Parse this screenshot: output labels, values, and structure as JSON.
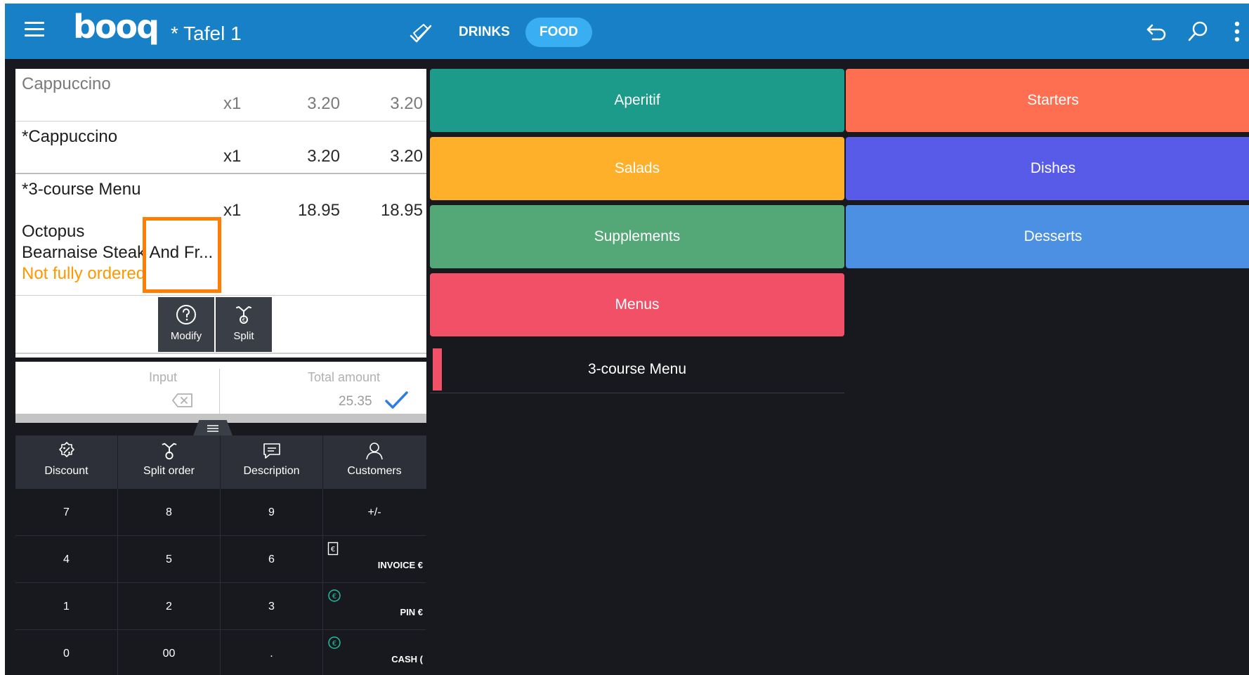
{
  "header": {
    "logo": "booq",
    "table_name": "* Tafel 1",
    "tabs": [
      {
        "label": "DRINKS",
        "active": false
      },
      {
        "label": "FOOD",
        "active": true
      }
    ],
    "icons": [
      "menu-icon",
      "pencil-check-icon",
      "undo-icon",
      "search-icon",
      "more-vertical-icon"
    ]
  },
  "order": {
    "items": [
      {
        "name": "Cappuccino",
        "qty": "x1",
        "price": "3.20",
        "total": "3.20"
      },
      {
        "name": "*Cappuccino",
        "qty": "x1",
        "price": "3.20",
        "total": "3.20"
      },
      {
        "name": "*3-course Menu",
        "qty": "x1",
        "price": "18.95",
        "total": "18.95",
        "subitems": [
          "Octopus",
          "Bearnaise Steak And Fr..."
        ],
        "status": "Not fully ordered"
      }
    ],
    "actions": {
      "modify": "Modify",
      "split": "Split"
    }
  },
  "summary": {
    "input_label": "Input",
    "total_label": "Total amount",
    "total_amount": "25.35"
  },
  "functions": {
    "discount": "Discount",
    "split_order": "Split order",
    "description": "Description",
    "customers": "Customers"
  },
  "keypad": {
    "k7": "7",
    "k8": "8",
    "k9": "9",
    "plusminus": "+/-",
    "k4": "4",
    "k5": "5",
    "k6": "6",
    "k1": "1",
    "k2": "2",
    "k3": "3",
    "k0": "0",
    "k00": "00",
    "dot": ".",
    "invoice": "INVOICE €",
    "pin": "PIN €",
    "cash": "CASH ("
  },
  "categories": {
    "aperitif": "Aperitif",
    "starters": "Starters",
    "salads": "Salads",
    "dishes": "Dishes",
    "supplements": "Supplements",
    "desserts": "Desserts",
    "menus": "Menus"
  },
  "menu_list": {
    "item1": "3-course Menu"
  },
  "colors": {
    "topbar": "#1780c6",
    "active_tab": "#3aaef3",
    "aperitif": "#1c9a8a",
    "starters": "#fe6f51",
    "salads": "#ffb02a",
    "dishes": "#575be8",
    "supplements": "#54a877",
    "desserts": "#4b90e2",
    "menus": "#f25066",
    "highlight": "#ff7d00",
    "warning": "#ff9800"
  }
}
